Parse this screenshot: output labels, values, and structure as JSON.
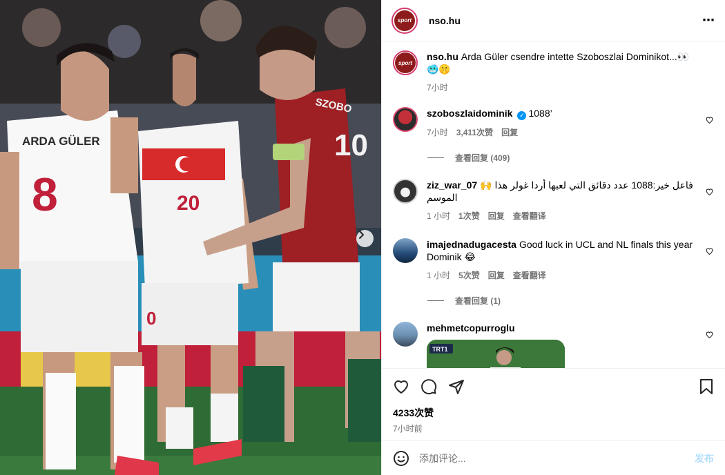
{
  "post": {
    "author": "nso.hu",
    "avatar_text": "sport",
    "caption_user": "nso.hu",
    "caption_text": "Arda Güler csendre intette Szoboszlai Dominikot...👀🥶🤫",
    "caption_time": "7小时",
    "more_icon": "⋯"
  },
  "photo": {
    "jersey_8_name": "ARDA GÜLER",
    "jersey_8_number": "8",
    "jersey_20_number": "20",
    "jersey_10_name": "SZOBO",
    "jersey_10_number": "10",
    "jersey_0_number": "0"
  },
  "comments": [
    {
      "user": "szoboszlaidominik",
      "verified": true,
      "text": "1088’",
      "time": "7小时",
      "likes": "3,411次赞",
      "reply": "回复",
      "view_replies": "查看回复 (409)"
    },
    {
      "user": "ziz_war_07",
      "text": "🙌 فاعل خير:1088 عدد دقائق التي لعبها أردا غولر هذا الموسم",
      "time": "1 小时",
      "likes": "1次赞",
      "reply": "回复",
      "translate": "查看翻译"
    },
    {
      "user": "imajednadugacesta",
      "text": "Good luck in UCL and NL finals this year Dominik 😂",
      "time": "1 小时",
      "likes": "5次赞",
      "reply": "回复",
      "translate": "查看翻译",
      "view_replies": "查看回复 (1)"
    },
    {
      "user": "mehmetcopurroglu",
      "text": "",
      "thumb_badge": "TRT1"
    }
  ],
  "actions": {
    "likes_count": "4233次赞",
    "time_ago": "7小时前"
  },
  "composer": {
    "placeholder": "添加评论...",
    "post_label": "发布"
  },
  "colors": {
    "accent": "#0095f6",
    "post_disabled": "#b2dffc",
    "meta_gray": "#737373"
  }
}
